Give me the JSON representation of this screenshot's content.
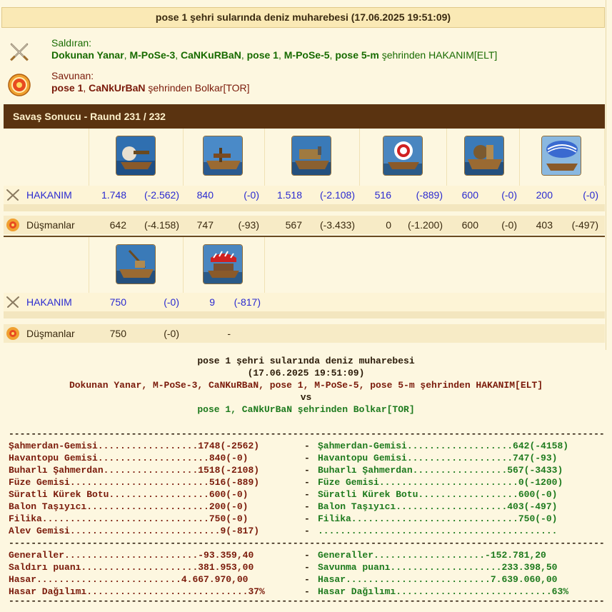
{
  "title": "pose 1 şehri sularında deniz muharebesi (17.06.2025 19:51:09)",
  "attacker": {
    "role": "Saldıran:",
    "names": [
      "Dokunan Yanar",
      "M-PoSe-3",
      "CaNKuRBaN",
      "pose 1",
      "M-PoSe-5",
      "pose 5-m"
    ],
    "suffix": "şehrinden HAKANIM[ELT]"
  },
  "defender": {
    "role": "Savunan:",
    "names": [
      "pose 1",
      "CaNkUrBaN"
    ],
    "suffix": "şehrinden Bolkar[TOR]"
  },
  "result_label": "Savaş Sonucu - Raund 231 / 232",
  "side_labels": {
    "attacker": "HAKANIM",
    "defender": "Düşmanlar"
  },
  "units_row1": [
    {
      "icon": "ram-ship-icon",
      "att": "1.748",
      "att_loss": "(-2.562)",
      "def": "642",
      "def_loss": "(-4.158)"
    },
    {
      "icon": "catapult-ship-icon",
      "att": "840",
      "att_loss": "(-0)",
      "def": "747",
      "def_loss": "(-93)"
    },
    {
      "icon": "steam-ram-icon",
      "att": "1.518",
      "att_loss": "(-2.108)",
      "def": "567",
      "def_loss": "(-3.433)"
    },
    {
      "icon": "rocket-ship-icon",
      "att": "516",
      "att_loss": "(-889)",
      "def": "0",
      "def_loss": "(-1.200)"
    },
    {
      "icon": "paddle-speedboat-icon",
      "att": "600",
      "att_loss": "(-0)",
      "def": "600",
      "def_loss": "(-0)"
    },
    {
      "icon": "balloon-carrier-icon",
      "att": "200",
      "att_loss": "(-0)",
      "def": "403",
      "def_loss": "(-497)"
    }
  ],
  "units_row2": [
    {
      "icon": "tender-icon",
      "att": "750",
      "att_loss": "(-0)",
      "def": "750",
      "def_loss": "(-0)"
    },
    {
      "icon": "fire-ship-icon",
      "att": "9",
      "att_loss": "(-817)",
      "def": "-",
      "def_loss": ""
    }
  ],
  "report": {
    "title": "pose 1 şehri sularında deniz muharebesi",
    "date": "(17.06.2025 19:51:09)",
    "attackers_line": "Dokunan Yanar, M-PoSe-3, CaNKuRBaN, pose 1, M-PoSe-5, pose 5-m şehrinden HAKANIM[ELT]",
    "vs": "vs",
    "defenders_line": "pose 1, CaNkUrBaN şehrinden Bolkar[TOR]",
    "separator": "-------------------------------------------------------------------------------------------------------------------------------",
    "unit_lines": [
      {
        "left": "Şahmerdan-Gemisi..................1748(-2562)",
        "right": "Şahmerdan-Gemisi...................642(-4158)"
      },
      {
        "left": "Havantopu Gemisi....................840(-0)",
        "right": "Havantopu Gemisi...................747(-93)"
      },
      {
        "left": "Buharlı Şahmerdan.................1518(-2108)",
        "right": "Buharlı Şahmerdan.................567(-3433)"
      },
      {
        "left": "Füze Gemisi.........................516(-889)",
        "right": "Füze Gemisi.........................0(-1200)"
      },
      {
        "left": "Süratli Kürek Botu..................600(-0)",
        "right": "Süratli Kürek Botu..................600(-0)"
      },
      {
        "left": "Balon Taşıyıcı......................200(-0)",
        "right": "Balon Taşıyıcı....................403(-497)"
      },
      {
        "left": "Filika..............................750(-0)",
        "right": "Filika..............................750(-0)"
      },
      {
        "left": "Alev Gemisi...........................9(-817)",
        "right": "..........................................."
      }
    ],
    "stat_lines": [
      {
        "left": "Generaller........................-93.359,40",
        "right": "Generaller....................-152.781,20"
      },
      {
        "left": "Saldırı puanı.....................381.953,00",
        "right": "Savunma puanı....................233.398,50"
      },
      {
        "left": "Hasar..........................4.667.970,00",
        "right": "Hasar..........................7.639.060,00"
      },
      {
        "left": "Hasar Dağılımı.............................37%",
        "right": "Hasar Dağılımı............................63%"
      }
    ],
    "dash": "-"
  }
}
